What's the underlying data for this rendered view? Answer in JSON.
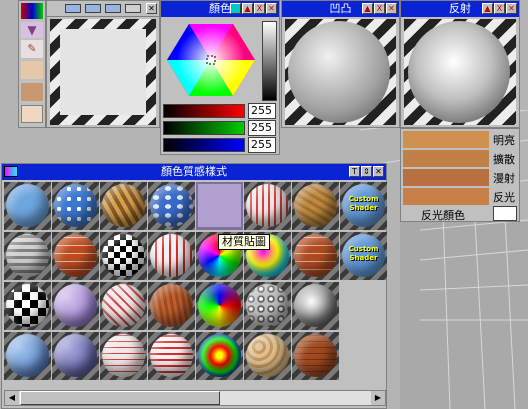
{
  "color_panel": {
    "title": "顏色",
    "r": "255",
    "g": "255",
    "b": "255"
  },
  "bump_panel": {
    "title": "凹凸"
  },
  "reflect_panel": {
    "title": "反射"
  },
  "material_panel": {
    "title": "顏色質感樣式",
    "tooltip": "材質貼圖"
  },
  "side_options": {
    "labels": [
      "明亮",
      "擴散",
      "漫射",
      "反光"
    ],
    "reflect_color": "反光顏色"
  },
  "custom_shader": "Custom Shader",
  "accent": "#0a24d4"
}
